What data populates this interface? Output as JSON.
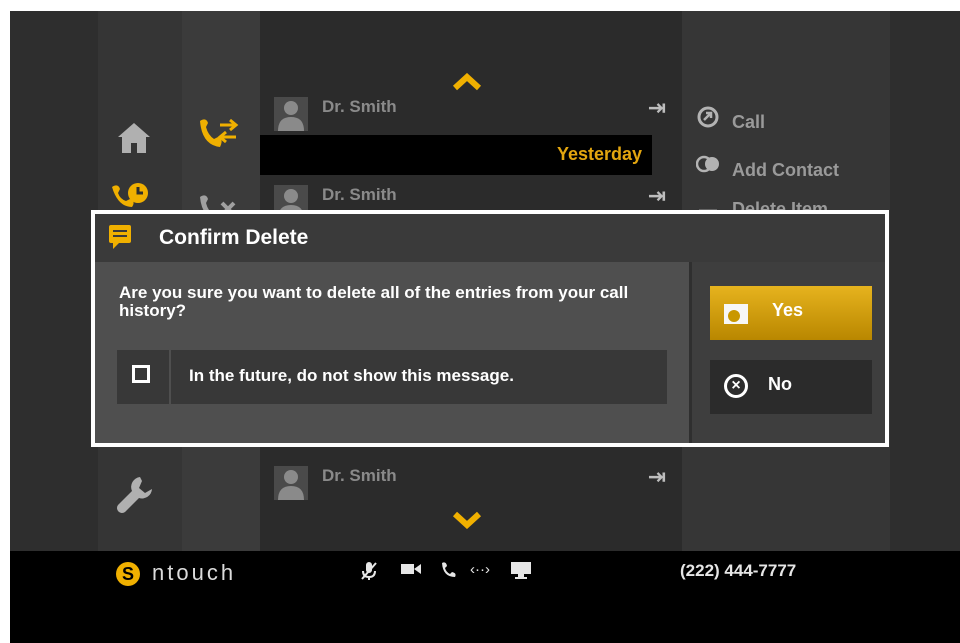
{
  "list": {
    "scroll_up_icon": "chevron-up-icon",
    "entries": [
      {
        "name": "Dr. Smith"
      },
      {
        "name": "Dr. Smith"
      },
      {
        "name": "Dr. Smith"
      }
    ],
    "date_header": "Yesterday",
    "scroll_down_icon": "chevron-down-icon"
  },
  "actions": {
    "call": "Call",
    "add_contact": "Add Contact",
    "delete_item": "Delete Item"
  },
  "dialog": {
    "title": "Confirm Delete",
    "message": "Are you sure you want to delete all of the entries from your call history?",
    "checkbox_label": "In the future, do not show this message.",
    "checkbox_checked": false,
    "yes_label": "Yes",
    "no_label": "No"
  },
  "taskbar": {
    "brand": "ntouch",
    "phone_number": "(222) 444-7777",
    "status_icons": [
      "mic-muted-icon",
      "video-camera-icon",
      "phone-icon",
      "connection-icon",
      "monitor-icon"
    ]
  },
  "colors": {
    "accent": "#f0b000",
    "background": "#2e2e2e",
    "taskbar": "#000000"
  }
}
